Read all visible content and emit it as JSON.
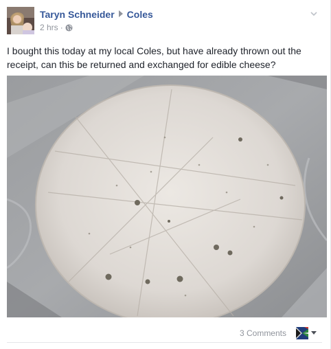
{
  "post": {
    "author": "Taryn Schneider",
    "target_page": "Coles",
    "timestamp": "2 hrs",
    "audience_icon": "globe-icon",
    "text": "I bought this today at my local Coles, but have already thrown out the receipt, can this be returned and exchanged for edible cheese?",
    "photo_description_icon": "cheese-photo"
  },
  "footer": {
    "comments_label": "3 Comments"
  },
  "icons": {
    "options": "chevron-down-icon",
    "share_as": "flag-avatar-icon",
    "caret": "caret-down-icon"
  },
  "colors": {
    "link_blue": "#365899",
    "meta_gray": "#90949c",
    "text_dark": "#1d2129"
  }
}
